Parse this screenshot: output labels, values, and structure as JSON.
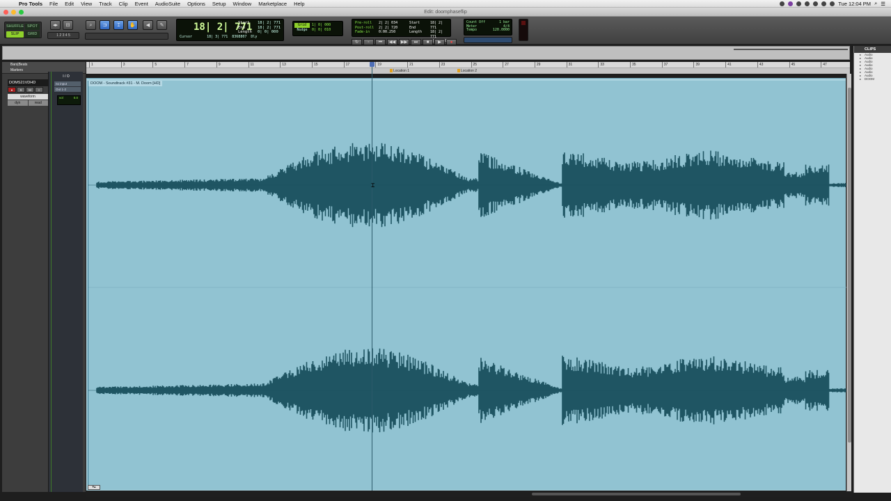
{
  "menubar": {
    "app_name": "Pro Tools",
    "items": [
      "File",
      "Edit",
      "View",
      "Track",
      "Clip",
      "Event",
      "AudioSuite",
      "Options",
      "Setup",
      "Window",
      "Marketplace",
      "Help"
    ],
    "clock": "Tue 12:04 PM"
  },
  "window": {
    "title": "Edit: doomphaseflip"
  },
  "toolbar": {
    "modes": [
      "SHUFFLE",
      "SPOT",
      "SLIP",
      "GRID"
    ],
    "active_mode": "SLIP",
    "main_counter": "18| 2| 771",
    "selection": {
      "start_label": "Start",
      "start": "18| 2| 771",
      "end_label": "End",
      "end": "18| 2| 771",
      "length_label": "Length",
      "length": "0| 0| 000"
    },
    "cursor_label": "Cursor",
    "cursor_value": "18| 3| 771",
    "sample_value": "8368807",
    "dly_label": "Dly",
    "grid_label": "Grid",
    "grid_value": "1| 0| 000",
    "nudge_label": "Nudge",
    "nudge_value": "0| 0| 010",
    "preroll_label": "Pre-roll",
    "preroll": "2| 2| 034",
    "postroll_label": "Post-roll",
    "postroll": "2| 2| 720",
    "fadein_label": "Fade-in",
    "fadein": "0:00.250",
    "pp_start_label": "Start",
    "pp_start": "18| 2| 771",
    "pp_end_label": "End",
    "pp_end": "18| 2| 771",
    "pp_length_label": "Length",
    "pp_length": "0| 0| 000",
    "count_off": "Count Off",
    "count_off_value": "1 bar",
    "meter_label": "Meter",
    "meter_value": "4/4",
    "tempo_label": "Tempo",
    "tempo_value": "120.0000",
    "colors": {
      "lcd_green": "#8ef24a",
      "mode_on": "#8fd12b",
      "tool_on": "#3a78d0"
    }
  },
  "left": {
    "ruler_labels": [
      "Bars|Beats",
      "Markers"
    ],
    "io_header": "I / O",
    "track_name": "DOMS21VDHD",
    "track_buttons": [
      "●",
      "S",
      "M",
      "I"
    ],
    "view_select": "waveform",
    "dyn": "dyn",
    "read": "read",
    "io_input": "no input",
    "io_output": "Out 1-2",
    "vol_label": "vol",
    "vol_value": "0.0"
  },
  "ruler": {
    "bars": [
      "1",
      "3",
      "5",
      "7",
      "9",
      "11",
      "13",
      "15",
      "17",
      "19",
      "21",
      "23",
      "25",
      "27",
      "29",
      "31",
      "33",
      "35",
      "37",
      "39",
      "41",
      "43",
      "45",
      "47"
    ],
    "markers": [
      {
        "label": "Location 1"
      },
      {
        "label": "Location 2"
      }
    ]
  },
  "clip": {
    "name": "DOOM - Soundtrack #31 - M. Doom [HD]",
    "color": "#91c3d2",
    "wave_color": "#1f5563"
  },
  "clips_panel": {
    "title": "CLIPS",
    "items": [
      "Audio",
      "Audio",
      "Audio",
      "Audio",
      "Audio",
      "Audio",
      "Audio",
      "DOOM"
    ]
  }
}
